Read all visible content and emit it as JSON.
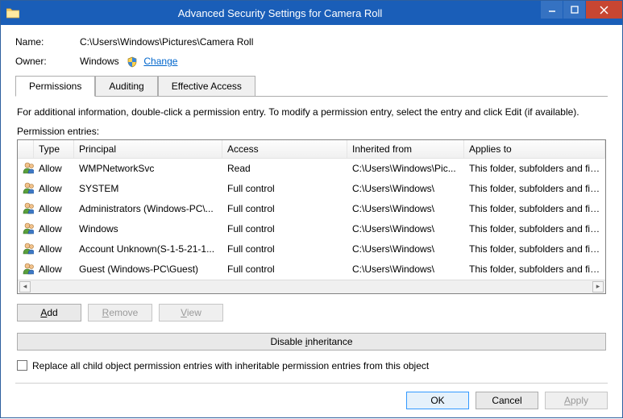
{
  "window": {
    "title": "Advanced Security Settings for Camera Roll"
  },
  "fields": {
    "name_label": "Name:",
    "name_value": "C:\\Users\\Windows\\Pictures\\Camera Roll",
    "owner_label": "Owner:",
    "owner_value": "Windows",
    "change_link": "Change"
  },
  "tabs": {
    "permissions": "Permissions",
    "auditing": "Auditing",
    "effective": "Effective Access"
  },
  "info_text": "For additional information, double-click a permission entry. To modify a permission entry, select the entry and click Edit (if available).",
  "entries_label": "Permission entries:",
  "columns": {
    "type": "Type",
    "principal": "Principal",
    "access": "Access",
    "inherited": "Inherited from",
    "applies": "Applies to"
  },
  "rows": [
    {
      "type": "Allow",
      "principal": "WMPNetworkSvc",
      "access": "Read",
      "inherited": "C:\\Users\\Windows\\Pic...",
      "applies": "This folder, subfolders and files"
    },
    {
      "type": "Allow",
      "principal": "SYSTEM",
      "access": "Full control",
      "inherited": "C:\\Users\\Windows\\",
      "applies": "This folder, subfolders and files"
    },
    {
      "type": "Allow",
      "principal": "Administrators (Windows-PC\\...",
      "access": "Full control",
      "inherited": "C:\\Users\\Windows\\",
      "applies": "This folder, subfolders and files"
    },
    {
      "type": "Allow",
      "principal": "Windows",
      "access": "Full control",
      "inherited": "C:\\Users\\Windows\\",
      "applies": "This folder, subfolders and files"
    },
    {
      "type": "Allow",
      "principal": "Account Unknown(S-1-5-21-1...",
      "access": "Full control",
      "inherited": "C:\\Users\\Windows\\",
      "applies": "This folder, subfolders and files"
    },
    {
      "type": "Allow",
      "principal": "Guest (Windows-PC\\Guest)",
      "access": "Full control",
      "inherited": "C:\\Users\\Windows\\",
      "applies": "This folder, subfolders and files"
    }
  ],
  "buttons": {
    "add": "Add",
    "remove": "Remove",
    "view": "View",
    "disable_inheritance": "Disable inheritance",
    "ok": "OK",
    "cancel": "Cancel",
    "apply": "Apply"
  },
  "checkbox_label": "Replace all child object permission entries with inheritable permission entries from this object"
}
